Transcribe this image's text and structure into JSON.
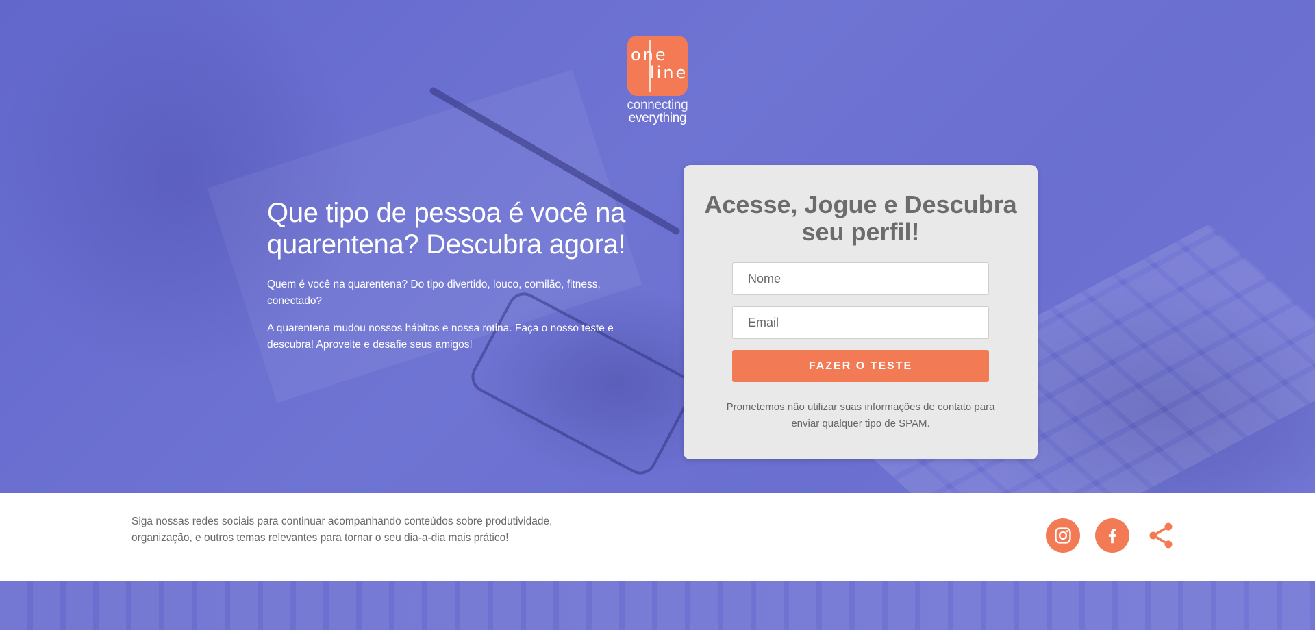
{
  "brand": {
    "logo_word1": "one",
    "logo_word2": "line",
    "tagline1": "connecting",
    "tagline2": "everything",
    "accent_color": "#f27b55",
    "hero_color": "#6c6fcf"
  },
  "hero": {
    "headline": "Que tipo de pessoa é você na quarentena? Descubra agora!",
    "paragraph1": "Quem é você na quarentena? Do tipo divertido, louco, comilão, fitness, conectado?",
    "paragraph2": "A quarentena mudou nossos hábitos e nossa rotina. Faça o nosso teste e descubra! Aproveite e desafie seus amigos!"
  },
  "form": {
    "title": "Acesse, Jogue e Descubra seu perfil!",
    "name_placeholder": "Nome",
    "email_placeholder": "Email",
    "submit_label": "FAZER O TESTE",
    "disclaimer": "Prometemos não utilizar suas informações de contato para enviar qualquer tipo de SPAM."
  },
  "footer": {
    "text": "Siga nossas redes sociais para continuar acompanhando conteúdos sobre produtividade, organização, e outros temas relevantes para tornar o seu dia-a-dia mais prático!",
    "social_icons": [
      "instagram-icon",
      "facebook-icon",
      "share-icon"
    ]
  }
}
